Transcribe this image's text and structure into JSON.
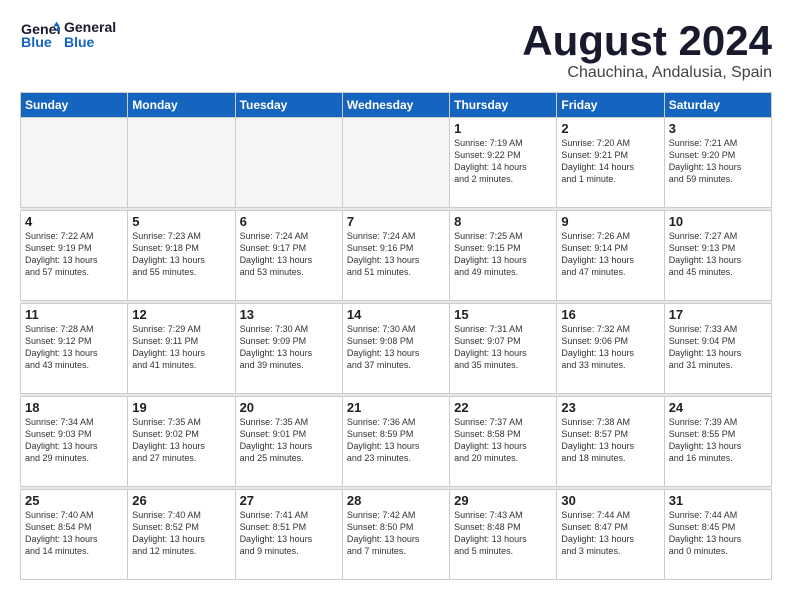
{
  "header": {
    "logo_line1": "General",
    "logo_line2": "Blue",
    "month_year": "August 2024",
    "location": "Chauchina, Andalusia, Spain"
  },
  "weekdays": [
    "Sunday",
    "Monday",
    "Tuesday",
    "Wednesday",
    "Thursday",
    "Friday",
    "Saturday"
  ],
  "weeks": [
    [
      {
        "day": "",
        "info": ""
      },
      {
        "day": "",
        "info": ""
      },
      {
        "day": "",
        "info": ""
      },
      {
        "day": "",
        "info": ""
      },
      {
        "day": "1",
        "info": "Sunrise: 7:19 AM\nSunset: 9:22 PM\nDaylight: 14 hours\nand 2 minutes."
      },
      {
        "day": "2",
        "info": "Sunrise: 7:20 AM\nSunset: 9:21 PM\nDaylight: 14 hours\nand 1 minute."
      },
      {
        "day": "3",
        "info": "Sunrise: 7:21 AM\nSunset: 9:20 PM\nDaylight: 13 hours\nand 59 minutes."
      }
    ],
    [
      {
        "day": "4",
        "info": "Sunrise: 7:22 AM\nSunset: 9:19 PM\nDaylight: 13 hours\nand 57 minutes."
      },
      {
        "day": "5",
        "info": "Sunrise: 7:23 AM\nSunset: 9:18 PM\nDaylight: 13 hours\nand 55 minutes."
      },
      {
        "day": "6",
        "info": "Sunrise: 7:24 AM\nSunset: 9:17 PM\nDaylight: 13 hours\nand 53 minutes."
      },
      {
        "day": "7",
        "info": "Sunrise: 7:24 AM\nSunset: 9:16 PM\nDaylight: 13 hours\nand 51 minutes."
      },
      {
        "day": "8",
        "info": "Sunrise: 7:25 AM\nSunset: 9:15 PM\nDaylight: 13 hours\nand 49 minutes."
      },
      {
        "day": "9",
        "info": "Sunrise: 7:26 AM\nSunset: 9:14 PM\nDaylight: 13 hours\nand 47 minutes."
      },
      {
        "day": "10",
        "info": "Sunrise: 7:27 AM\nSunset: 9:13 PM\nDaylight: 13 hours\nand 45 minutes."
      }
    ],
    [
      {
        "day": "11",
        "info": "Sunrise: 7:28 AM\nSunset: 9:12 PM\nDaylight: 13 hours\nand 43 minutes."
      },
      {
        "day": "12",
        "info": "Sunrise: 7:29 AM\nSunset: 9:11 PM\nDaylight: 13 hours\nand 41 minutes."
      },
      {
        "day": "13",
        "info": "Sunrise: 7:30 AM\nSunset: 9:09 PM\nDaylight: 13 hours\nand 39 minutes."
      },
      {
        "day": "14",
        "info": "Sunrise: 7:30 AM\nSunset: 9:08 PM\nDaylight: 13 hours\nand 37 minutes."
      },
      {
        "day": "15",
        "info": "Sunrise: 7:31 AM\nSunset: 9:07 PM\nDaylight: 13 hours\nand 35 minutes."
      },
      {
        "day": "16",
        "info": "Sunrise: 7:32 AM\nSunset: 9:06 PM\nDaylight: 13 hours\nand 33 minutes."
      },
      {
        "day": "17",
        "info": "Sunrise: 7:33 AM\nSunset: 9:04 PM\nDaylight: 13 hours\nand 31 minutes."
      }
    ],
    [
      {
        "day": "18",
        "info": "Sunrise: 7:34 AM\nSunset: 9:03 PM\nDaylight: 13 hours\nand 29 minutes."
      },
      {
        "day": "19",
        "info": "Sunrise: 7:35 AM\nSunset: 9:02 PM\nDaylight: 13 hours\nand 27 minutes."
      },
      {
        "day": "20",
        "info": "Sunrise: 7:35 AM\nSunset: 9:01 PM\nDaylight: 13 hours\nand 25 minutes."
      },
      {
        "day": "21",
        "info": "Sunrise: 7:36 AM\nSunset: 8:59 PM\nDaylight: 13 hours\nand 23 minutes."
      },
      {
        "day": "22",
        "info": "Sunrise: 7:37 AM\nSunset: 8:58 PM\nDaylight: 13 hours\nand 20 minutes."
      },
      {
        "day": "23",
        "info": "Sunrise: 7:38 AM\nSunset: 8:57 PM\nDaylight: 13 hours\nand 18 minutes."
      },
      {
        "day": "24",
        "info": "Sunrise: 7:39 AM\nSunset: 8:55 PM\nDaylight: 13 hours\nand 16 minutes."
      }
    ],
    [
      {
        "day": "25",
        "info": "Sunrise: 7:40 AM\nSunset: 8:54 PM\nDaylight: 13 hours\nand 14 minutes."
      },
      {
        "day": "26",
        "info": "Sunrise: 7:40 AM\nSunset: 8:52 PM\nDaylight: 13 hours\nand 12 minutes."
      },
      {
        "day": "27",
        "info": "Sunrise: 7:41 AM\nSunset: 8:51 PM\nDaylight: 13 hours\nand 9 minutes."
      },
      {
        "day": "28",
        "info": "Sunrise: 7:42 AM\nSunset: 8:50 PM\nDaylight: 13 hours\nand 7 minutes."
      },
      {
        "day": "29",
        "info": "Sunrise: 7:43 AM\nSunset: 8:48 PM\nDaylight: 13 hours\nand 5 minutes."
      },
      {
        "day": "30",
        "info": "Sunrise: 7:44 AM\nSunset: 8:47 PM\nDaylight: 13 hours\nand 3 minutes."
      },
      {
        "day": "31",
        "info": "Sunrise: 7:44 AM\nSunset: 8:45 PM\nDaylight: 13 hours\nand 0 minutes."
      }
    ]
  ]
}
